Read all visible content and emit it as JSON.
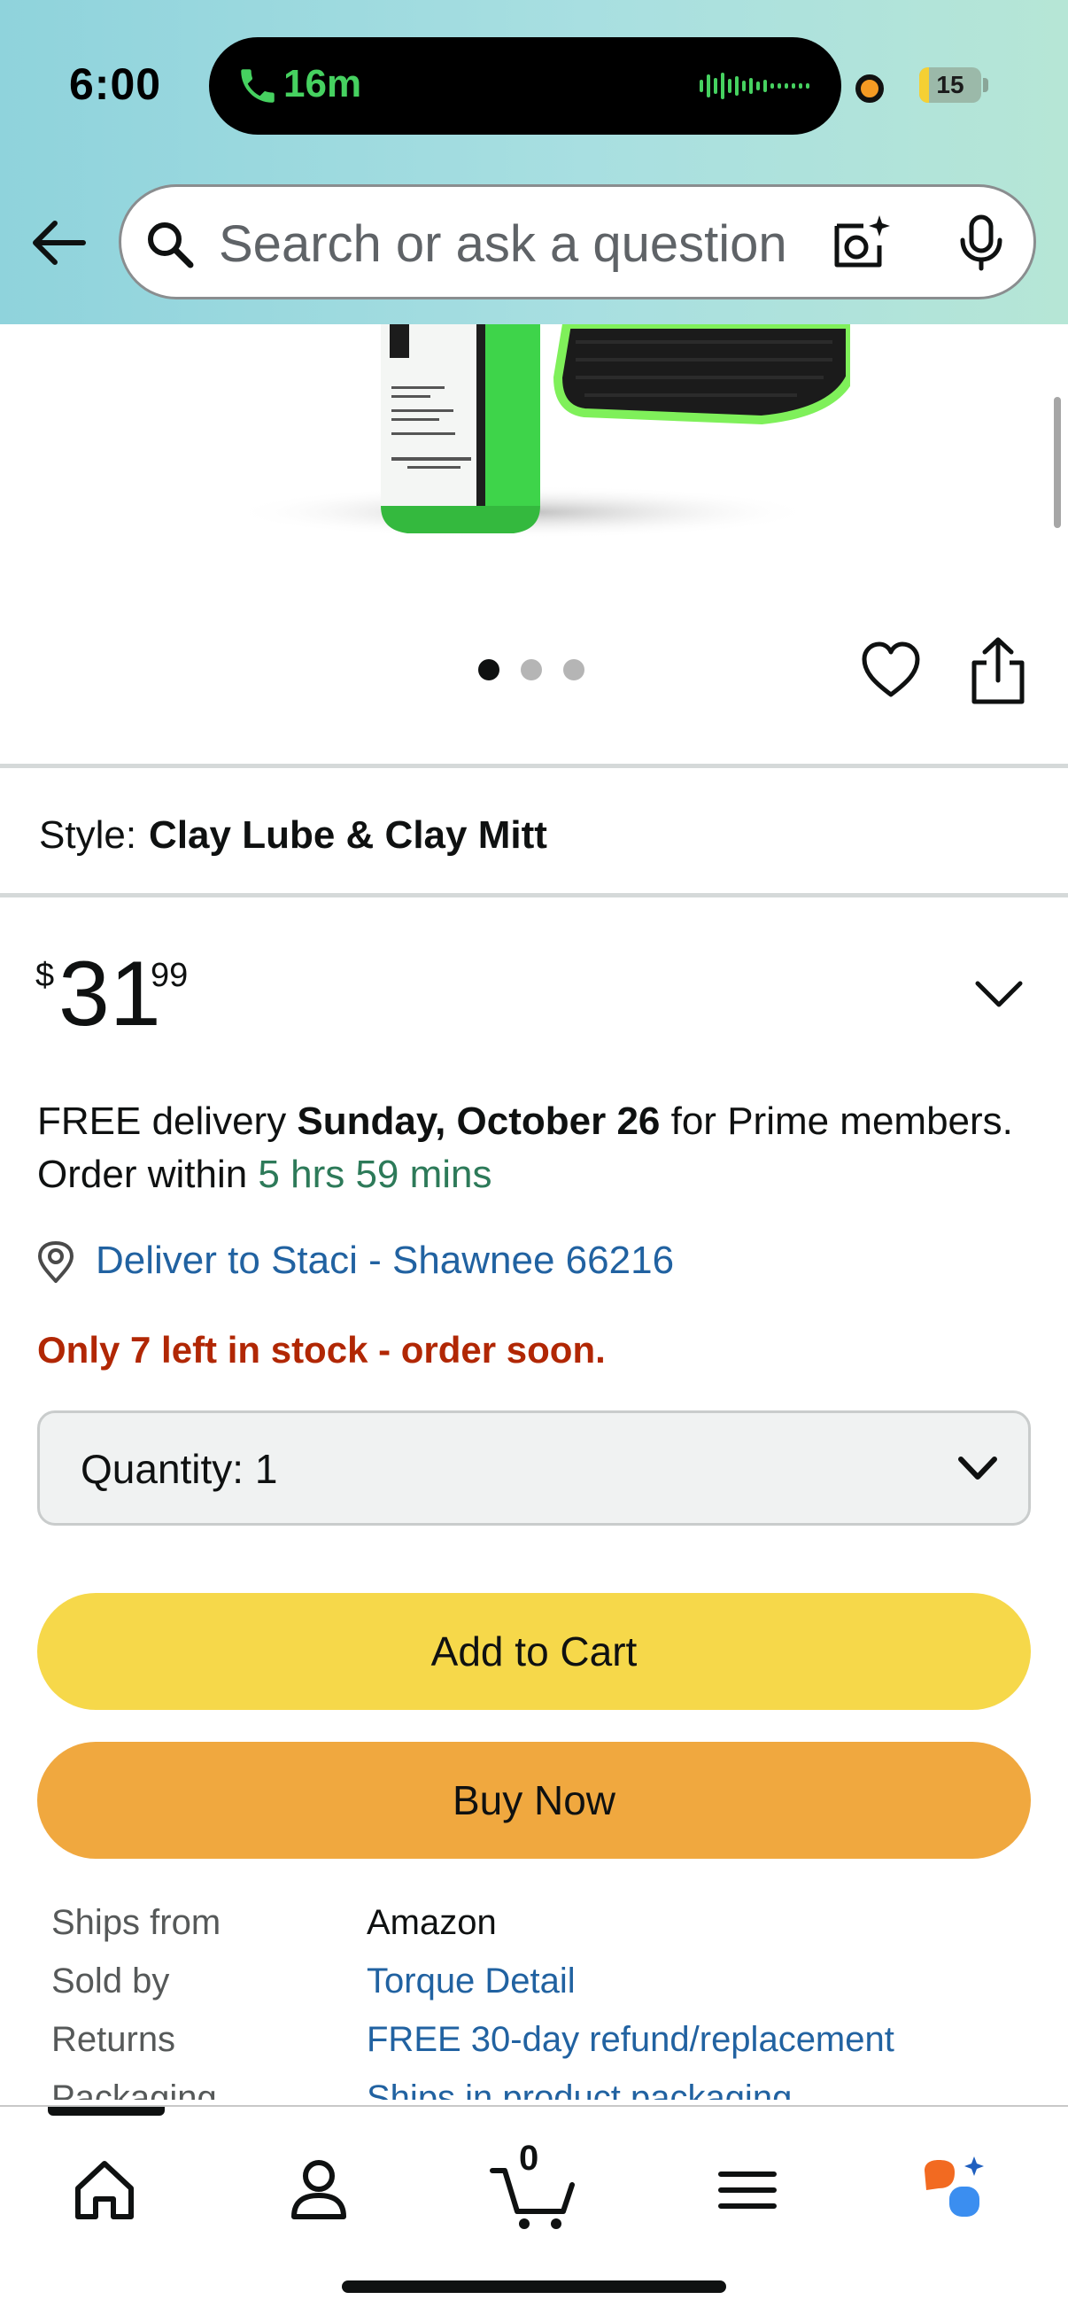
{
  "status_bar": {
    "time": "6:00",
    "call_duration": "16m",
    "battery_level": "15",
    "battery_fraction": 0.15
  },
  "search": {
    "placeholder": "Search or ask a question"
  },
  "carousel": {
    "count": 3,
    "active_index": 0
  },
  "style": {
    "label": "Style:",
    "value": "Clay Lube & Clay Mitt"
  },
  "price": {
    "symbol": "$",
    "whole": "31",
    "fraction": "99"
  },
  "delivery": {
    "prefix": "FREE delivery ",
    "date": "Sunday, October 26",
    "middle": " for Prime members. Order within ",
    "countdown": "5 hrs 59 mins",
    "deliver_to": "Deliver to Staci - Shawnee 66216"
  },
  "stock": {
    "message": "Only 7 left in stock - order soon."
  },
  "quantity": {
    "label": "Quantity:",
    "value": "1"
  },
  "buttons": {
    "add_to_cart": "Add to Cart",
    "buy_now": "Buy Now"
  },
  "details": [
    {
      "key": "Ships from",
      "value": "Amazon",
      "link": false
    },
    {
      "key": "Sold by",
      "value": "Torque Detail",
      "link": true
    },
    {
      "key": "Returns",
      "value": "FREE 30-day refund/replacement",
      "link": true
    },
    {
      "key": "Packaging",
      "value": "Ships in product packaging",
      "link": true
    }
  ],
  "nav": {
    "cart_count": "0",
    "items": [
      "home-icon",
      "account-icon",
      "cart-icon",
      "menu-icon",
      "rufus-icon"
    ]
  },
  "colors": {
    "link_blue": "#2162a1",
    "stock_red": "#b12704",
    "countdown_green": "#2d7a59",
    "add_to_cart_yellow": "#f6d84a",
    "buy_now_orange": "#f0a83f"
  }
}
